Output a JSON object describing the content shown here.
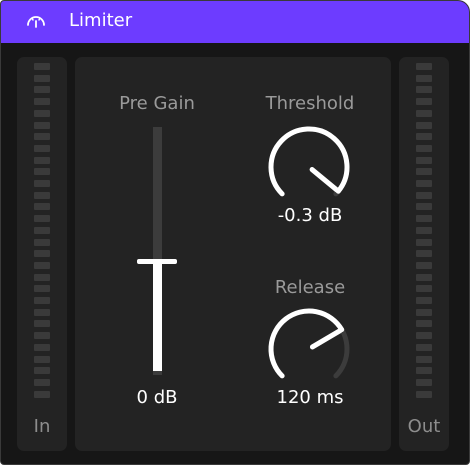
{
  "window": {
    "title": "Limiter",
    "icon": "limiter-device-icon"
  },
  "colors": {
    "titlebar": "#6d3cff",
    "background": "#161616",
    "panel": "#232323",
    "accent": "#ffffff",
    "inactive": "#3c3c3c"
  },
  "meters": {
    "in_label": "In",
    "out_label": "Out"
  },
  "pre_gain": {
    "label": "Pre Gain",
    "value": "0 dB",
    "level": 0.46
  },
  "threshold": {
    "label": "Threshold",
    "value": "-0.3 dB",
    "level": 0.98
  },
  "release": {
    "label": "Release",
    "value": "120 ms",
    "level": 0.72
  }
}
